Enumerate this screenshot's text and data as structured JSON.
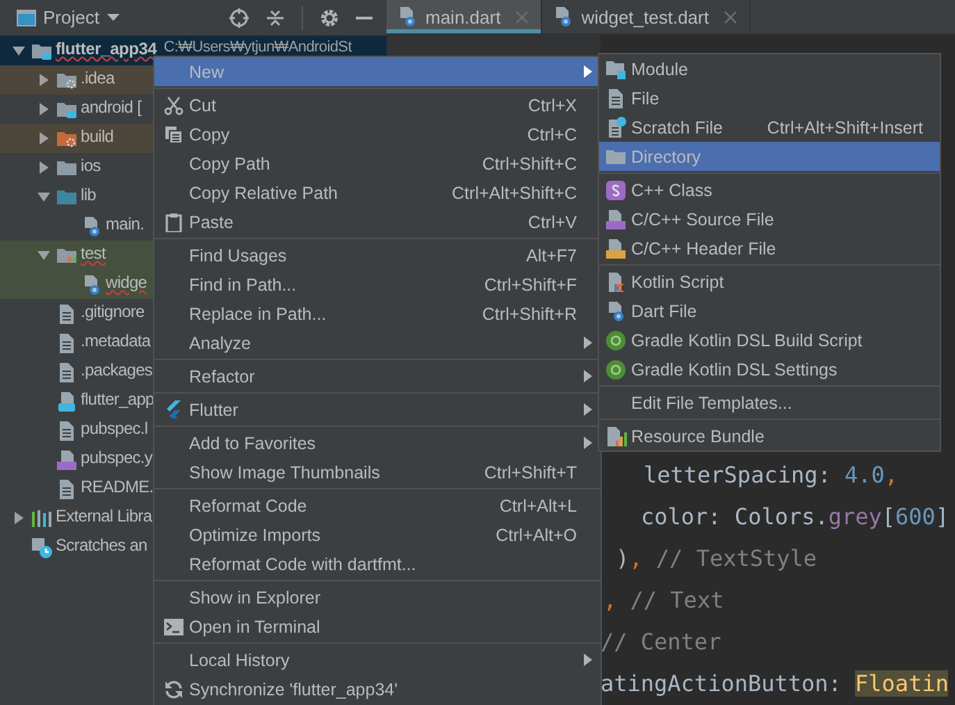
{
  "project_panel": {
    "title": "Project",
    "tree": [
      {
        "label": "flutter_app34",
        "detail": "C:₩Users₩ytjun₩AndroidSt",
        "kind": "module-folder",
        "expanded": true,
        "selected": true,
        "error": true,
        "children": [
          {
            "label": ".idea",
            "kind": "config-folder",
            "expanded": false,
            "selected": false,
            "error": false,
            "color": "#4d463a"
          },
          {
            "label": "android [",
            "kind": "module-folder",
            "expanded": false,
            "selected": false,
            "error": false
          },
          {
            "label": "build",
            "kind": "excluded-folder",
            "expanded": false,
            "selected": false,
            "error": false,
            "color": "#4d463a"
          },
          {
            "label": "ios",
            "kind": "folder",
            "expanded": false,
            "selected": false,
            "error": false
          },
          {
            "label": "lib",
            "kind": "source-folder",
            "expanded": true,
            "selected": false,
            "error": false,
            "children": [
              {
                "label": "main.",
                "kind": "dart-file",
                "selected": false,
                "error": false
              }
            ]
          },
          {
            "label": "test",
            "kind": "test-folder",
            "expanded": true,
            "selected": false,
            "error": true,
            "color": "#45503f",
            "children": [
              {
                "label": "widge",
                "kind": "dart-file",
                "selected": false,
                "error": true,
                "color": "#45503f"
              }
            ]
          },
          {
            "label": ".gitignore",
            "kind": "text-file",
            "selected": false,
            "error": false
          },
          {
            "label": ".metadata",
            "kind": "text-file",
            "selected": false,
            "error": false
          },
          {
            "label": ".packages",
            "kind": "text-file",
            "selected": false,
            "error": false
          },
          {
            "label": "flutter_app",
            "kind": "module-file",
            "selected": false,
            "error": false
          },
          {
            "label": "pubspec.l",
            "kind": "text-file",
            "selected": false,
            "error": false
          },
          {
            "label": "pubspec.y",
            "kind": "yml-file",
            "selected": false,
            "error": false
          },
          {
            "label": "README.",
            "kind": "text-file",
            "selected": false,
            "error": false
          }
        ]
      },
      {
        "label": "External Libra",
        "kind": "libraries",
        "expanded": false,
        "selected": false,
        "error": false
      },
      {
        "label": "Scratches an",
        "kind": "scratches",
        "selected": false,
        "error": false
      }
    ]
  },
  "editor": {
    "tabs": [
      {
        "label": "main.dart",
        "selected": true
      },
      {
        "label": "widget_test.dart",
        "selected": false
      }
    ],
    "code_lines": [
      {
        "segments": [
          {
            "kind": "plain",
            "text": "letterSpacing: "
          },
          {
            "kind": "number",
            "text": "4.0"
          },
          {
            "kind": "punct",
            "text": ","
          }
        ]
      },
      {
        "segments": [
          {
            "kind": "plain",
            "text": "color: Colors."
          },
          {
            "kind": "field",
            "text": "grey"
          },
          {
            "kind": "plain",
            "text": "["
          },
          {
            "kind": "number",
            "text": "600"
          },
          {
            "kind": "plain",
            "text": "]"
          }
        ]
      },
      {
        "segments": [
          {
            "kind": "plain",
            "text": ")"
          },
          {
            "kind": "punct",
            "text": ","
          },
          {
            "kind": "comment",
            "text": " // TextStyle"
          }
        ]
      },
      {
        "segments": [
          {
            "kind": "punct",
            "text": ","
          },
          {
            "kind": "comment",
            "text": " // Text"
          }
        ]
      },
      {
        "segments": [
          {
            "kind": "comment",
            "text": "// Center"
          }
        ]
      },
      {
        "segments": [
          {
            "kind": "plain",
            "text": "atingActionButton: "
          },
          {
            "kind": "highlight",
            "text": "Floatin"
          }
        ]
      }
    ]
  },
  "context_menu": {
    "items": [
      {
        "kind": "item",
        "label": "New",
        "submenu": true,
        "selected": true
      },
      {
        "kind": "separator"
      },
      {
        "kind": "item",
        "label": "Cut",
        "shortcut": "Ctrl+X",
        "submenu": false,
        "selected": false
      },
      {
        "kind": "item",
        "label": "Copy",
        "shortcut": "Ctrl+C",
        "submenu": false,
        "selected": false
      },
      {
        "kind": "item",
        "label": "Copy Path",
        "shortcut": "Ctrl+Shift+C",
        "submenu": false,
        "selected": false
      },
      {
        "kind": "item",
        "label": "Copy Relative Path",
        "shortcut": "Ctrl+Alt+Shift+C",
        "submenu": false,
        "selected": false
      },
      {
        "kind": "item",
        "label": "Paste",
        "shortcut": "Ctrl+V",
        "submenu": false,
        "selected": false
      },
      {
        "kind": "separator"
      },
      {
        "kind": "item",
        "label": "Find Usages",
        "shortcut": "Alt+F7",
        "submenu": false,
        "selected": false
      },
      {
        "kind": "item",
        "label": "Find in Path...",
        "shortcut": "Ctrl+Shift+F",
        "submenu": false,
        "selected": false
      },
      {
        "kind": "item",
        "label": "Replace in Path...",
        "shortcut": "Ctrl+Shift+R",
        "submenu": false,
        "selected": false
      },
      {
        "kind": "item",
        "label": "Analyze",
        "submenu": true,
        "selected": false
      },
      {
        "kind": "separator"
      },
      {
        "kind": "item",
        "label": "Refactor",
        "submenu": true,
        "selected": false
      },
      {
        "kind": "separator"
      },
      {
        "kind": "item",
        "label": "Flutter",
        "submenu": true,
        "selected": false
      },
      {
        "kind": "separator"
      },
      {
        "kind": "item",
        "label": "Add to Favorites",
        "submenu": true,
        "selected": false
      },
      {
        "kind": "item",
        "label": "Show Image Thumbnails",
        "shortcut": "Ctrl+Shift+T",
        "submenu": false,
        "selected": false
      },
      {
        "kind": "separator"
      },
      {
        "kind": "item",
        "label": "Reformat Code",
        "shortcut": "Ctrl+Alt+L",
        "submenu": false,
        "selected": false
      },
      {
        "kind": "item",
        "label": "Optimize Imports",
        "shortcut": "Ctrl+Alt+O",
        "submenu": false,
        "selected": false
      },
      {
        "kind": "item",
        "label": "Reformat Code with dartfmt...",
        "submenu": false,
        "selected": false
      },
      {
        "kind": "separator"
      },
      {
        "kind": "item",
        "label": "Show in Explorer",
        "submenu": false,
        "selected": false
      },
      {
        "kind": "item",
        "label": "Open in Terminal",
        "submenu": false,
        "selected": false
      },
      {
        "kind": "separator"
      },
      {
        "kind": "item",
        "label": "Local History",
        "submenu": true,
        "selected": false
      },
      {
        "kind": "item",
        "label": "Synchronize 'flutter_app34'",
        "submenu": false,
        "selected": false
      }
    ]
  },
  "new_submenu": {
    "items": [
      {
        "kind": "item",
        "label": "Module",
        "selected": false
      },
      {
        "kind": "item",
        "label": "File",
        "selected": false
      },
      {
        "kind": "item",
        "label": "Scratch File",
        "shortcut": "Ctrl+Alt+Shift+Insert",
        "selected": false
      },
      {
        "kind": "item",
        "label": "Directory",
        "selected": true
      },
      {
        "kind": "separator"
      },
      {
        "kind": "item",
        "label": "C++ Class",
        "selected": false
      },
      {
        "kind": "item",
        "label": "C/C++ Source File",
        "selected": false
      },
      {
        "kind": "item",
        "label": "C/C++ Header File",
        "selected": false
      },
      {
        "kind": "separator"
      },
      {
        "kind": "item",
        "label": "Kotlin Script",
        "selected": false
      },
      {
        "kind": "item",
        "label": "Dart File",
        "selected": false
      },
      {
        "kind": "item",
        "label": "Gradle Kotlin DSL Build Script",
        "selected": false
      },
      {
        "kind": "item",
        "label": "Gradle Kotlin DSL Settings",
        "selected": false
      },
      {
        "kind": "separator"
      },
      {
        "kind": "item",
        "label": "Edit File Templates...",
        "selected": false
      },
      {
        "kind": "separator"
      },
      {
        "kind": "item",
        "label": "Resource Bundle",
        "selected": false
      }
    ]
  }
}
